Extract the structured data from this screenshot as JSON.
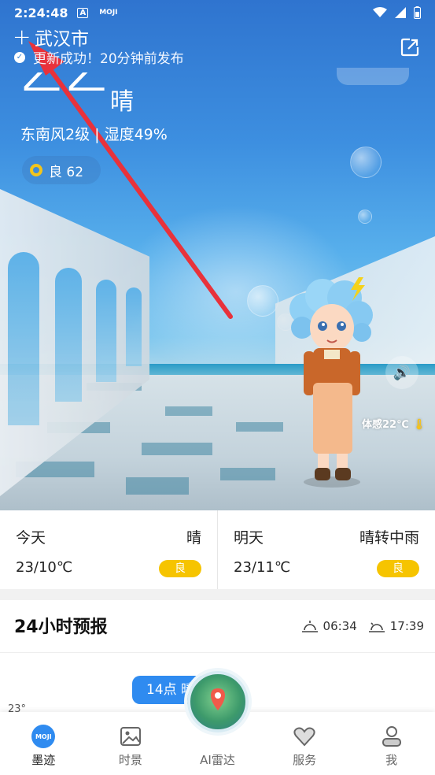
{
  "status_bar": {
    "time": "2:24:48",
    "indicator_a": "A",
    "indicator_moji": "MOJI"
  },
  "header": {
    "plus_label": "+",
    "city": "武汉市",
    "update_status": "更新成功！20分钟前发布"
  },
  "current": {
    "temperature": "22",
    "condition": "晴",
    "wind_humidity": "东南风2级 | 湿度49%",
    "aqi_label": "良 62",
    "feels_like": "体感22℃"
  },
  "days": [
    {
      "name": "今天",
      "condition": "晴",
      "temp": "23/10℃",
      "aqi": "良"
    },
    {
      "name": "明天",
      "condition": "晴转中雨",
      "temp": "23/11℃",
      "aqi": "良"
    }
  ],
  "forecast": {
    "title": "24小时预报",
    "sunrise": "06:34",
    "sunset": "17:39",
    "hour_pill": "14点 晴",
    "min_temp": "23°"
  },
  "nav": {
    "items": [
      {
        "label": "墨迹",
        "icon": "moji-logo-icon"
      },
      {
        "label": "时景",
        "icon": "photo-icon"
      },
      {
        "label": "AI雷达",
        "icon": "radar-icon"
      },
      {
        "label": "服务",
        "icon": "heart-icon"
      },
      {
        "label": "我",
        "icon": "user-icon"
      }
    ]
  },
  "colors": {
    "accent": "#2f8bf0",
    "aqi": "#f6c400",
    "arrow": "#e8323b"
  }
}
